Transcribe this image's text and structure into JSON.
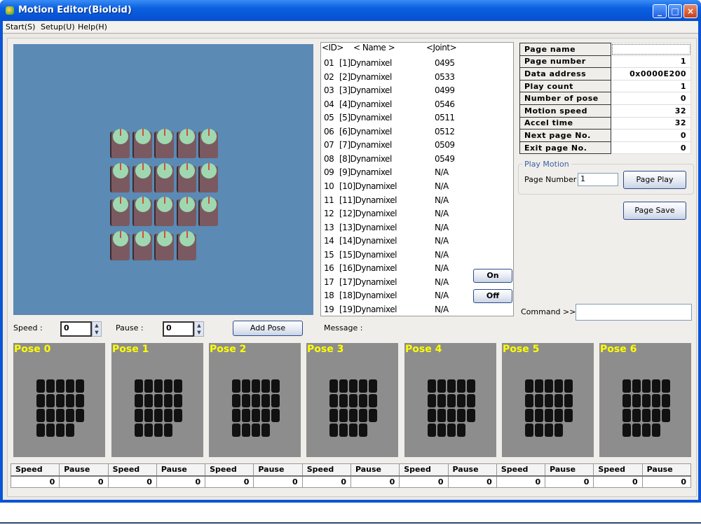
{
  "window": {
    "title": "Motion Editor(Bioloid)",
    "controls": [
      "_",
      "□",
      "×"
    ]
  },
  "menu": [
    "Start(S)",
    "Setup(U)",
    "Help(H)"
  ],
  "view3d": {
    "bg_color": "#5b8ab5",
    "servo_rows": [
      5,
      5,
      5,
      4
    ]
  },
  "servo_list": {
    "headers": {
      "id": "<ID>",
      "name": "< Name >",
      "joint": "<Joint>"
    },
    "rows": [
      {
        "id": "01",
        "name": "[1]Dynamixel",
        "joint": "0495"
      },
      {
        "id": "02",
        "name": "[2]Dynamixel",
        "joint": "0533"
      },
      {
        "id": "03",
        "name": "[3]Dynamixel",
        "joint": "0499"
      },
      {
        "id": "04",
        "name": "[4]Dynamixel",
        "joint": "0546"
      },
      {
        "id": "05",
        "name": "[5]Dynamixel",
        "joint": "0511"
      },
      {
        "id": "06",
        "name": "[6]Dynamixel",
        "joint": "0512"
      },
      {
        "id": "07",
        "name": "[7]Dynamixel",
        "joint": "0509"
      },
      {
        "id": "08",
        "name": "[8]Dynamixel",
        "joint": "0549"
      },
      {
        "id": "09",
        "name": "[9]Dynamixel",
        "joint": "N/A"
      },
      {
        "id": "10",
        "name": "[10]Dynamixel",
        "joint": "N/A"
      },
      {
        "id": "11",
        "name": "[11]Dynamixel",
        "joint": "N/A"
      },
      {
        "id": "12",
        "name": "[12]Dynamixel",
        "joint": "N/A"
      },
      {
        "id": "13",
        "name": "[13]Dynamixel",
        "joint": "N/A"
      },
      {
        "id": "14",
        "name": "[14]Dynamixel",
        "joint": "N/A"
      },
      {
        "id": "15",
        "name": "[15]Dynamixel",
        "joint": "N/A"
      },
      {
        "id": "16",
        "name": "[16]Dynamixel",
        "joint": "N/A"
      },
      {
        "id": "17",
        "name": "[17]Dynamixel",
        "joint": "N/A"
      },
      {
        "id": "18",
        "name": "[18]Dynamixel",
        "joint": "N/A"
      },
      {
        "id": "19",
        "name": "[19]Dynamixel",
        "joint": "N/A"
      }
    ],
    "on_label": "On",
    "off_label": "Off"
  },
  "page_props": [
    {
      "label": "Page name",
      "value": ""
    },
    {
      "label": "Page number",
      "value": "1"
    },
    {
      "label": "Data address",
      "value": "0x0000E200"
    },
    {
      "label": "Play count",
      "value": "1"
    },
    {
      "label": "Number of pose",
      "value": "0"
    },
    {
      "label": "Motion speed",
      "value": "32"
    },
    {
      "label": "Accel time",
      "value": "32"
    },
    {
      "label": "Next page No.",
      "value": "0"
    },
    {
      "label": "Exit page No.",
      "value": "0"
    }
  ],
  "play_motion": {
    "group_label": "Play Motion",
    "page_number_label": "Page Number :",
    "page_number_value": "1",
    "play_button": "Page Play"
  },
  "page_save_button": "Page Save",
  "command": {
    "label": "Command >>",
    "value": ""
  },
  "pose_controls": {
    "speed_label": "Speed :",
    "speed_value": "0",
    "pause_label": "Pause :",
    "pause_value": "0",
    "add_pose_button": "Add Pose",
    "message_label": "Message :"
  },
  "poses": [
    {
      "label": "Pose 0",
      "speed": "0",
      "pause": "0"
    },
    {
      "label": "Pose 1",
      "speed": "0",
      "pause": "0"
    },
    {
      "label": "Pose 2",
      "speed": "0",
      "pause": "0"
    },
    {
      "label": "Pose 3",
      "speed": "0",
      "pause": "0"
    },
    {
      "label": "Pose 4",
      "speed": "0",
      "pause": "0"
    },
    {
      "label": "Pose 5",
      "speed": "0",
      "pause": "0"
    },
    {
      "label": "Pose 6",
      "speed": "0",
      "pause": "0"
    }
  ],
  "pose_table_headers": {
    "speed": "Speed",
    "pause": "Pause"
  }
}
